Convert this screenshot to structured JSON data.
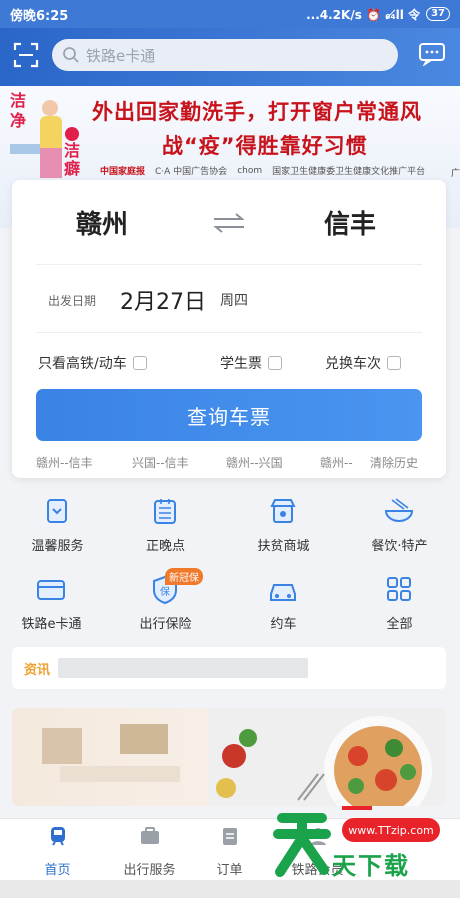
{
  "status": {
    "time": "傍晚6:25",
    "right": "...4.2K/s ⏰ ₆₄̸ll 令",
    "battery": "37"
  },
  "header": {
    "search_placeholder": "铁路e卡通"
  },
  "banner": {
    "line1": "外出回家勤洗手，打开窗户常通风",
    "line2": "战“疫”得胜靠好习惯",
    "side_text": "洁净 洁癖",
    "logos": [
      "中国家庭报",
      "C·A 中国广告协会",
      "chom",
      "国家卫生健康委卫生健康文化推广平台"
    ],
    "corner": "广"
  },
  "ticket": {
    "from": "赣州",
    "to": "信丰",
    "date_label": "出发日期",
    "date": "2月27日",
    "weekday": "周四",
    "options": [
      "只看高铁/动车",
      "学生票",
      "兑换车次"
    ],
    "query_label": "查询车票",
    "history": [
      "赣州--信丰",
      "兴国--信丰",
      "赣州--兴国",
      "赣州--",
      "清除历史"
    ]
  },
  "grid": [
    {
      "label": "温馨服务",
      "icon": "warm-service-icon"
    },
    {
      "label": "正晚点",
      "icon": "calendar-icon"
    },
    {
      "label": "扶贫商城",
      "icon": "shop-icon"
    },
    {
      "label": "餐饮·特产",
      "icon": "food-bowl-icon"
    },
    {
      "label": "铁路e卡通",
      "icon": "card-icon"
    },
    {
      "label": "出行保险",
      "icon": "insurance-icon"
    },
    {
      "label": "约车",
      "icon": "car-icon"
    },
    {
      "label": "全部",
      "icon": "all-grid-icon"
    }
  ],
  "insurance_tag": "新冠保",
  "news": {
    "label": "资讯"
  },
  "tabs": [
    {
      "label": "首页",
      "icon": "home-train-icon"
    },
    {
      "label": "出行服务",
      "icon": "briefcase-icon"
    },
    {
      "label": "订单",
      "icon": "order-icon"
    },
    {
      "label": "铁路会员",
      "icon": "member-icon"
    }
  ],
  "watermark": {
    "url": "www.TTzip.com",
    "text": "天下载"
  },
  "colors": {
    "primary": "#2f6fcf",
    "query_btn": "#3a83e5",
    "ad_red": "#c8131c",
    "tag": "#f07a2c"
  }
}
